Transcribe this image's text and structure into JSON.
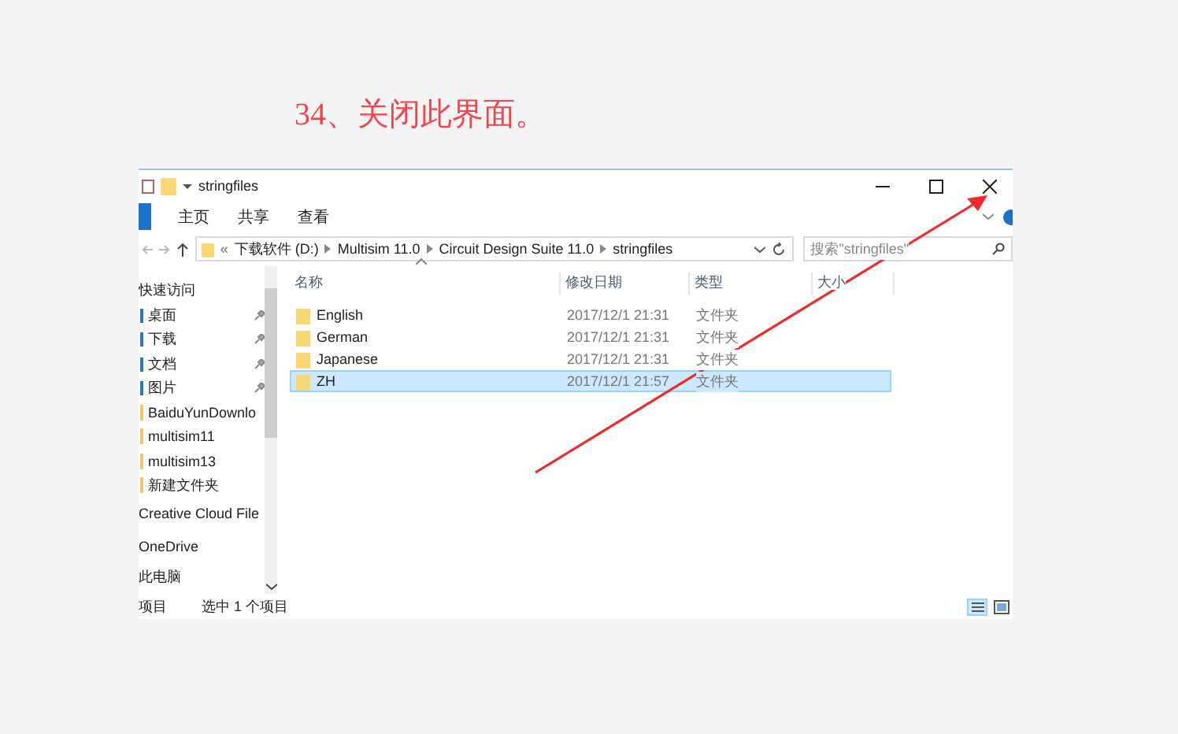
{
  "heading": "34、关闭此界面。",
  "window": {
    "title": "stringfiles"
  },
  "ribbon_tabs": [
    {
      "label": "主页",
      "selected": false
    },
    {
      "label": "共享",
      "selected": false
    },
    {
      "label": "查看",
      "selected": false
    }
  ],
  "address": {
    "overflow": "«",
    "crumbs": [
      "下载软件 (D:)",
      "Multisim 11.0",
      "Circuit Design Suite 11.0",
      "stringfiles"
    ]
  },
  "search": {
    "placeholder": "搜索\"stringfiles\""
  },
  "nav": [
    {
      "label": "快速访问",
      "kind": "header"
    },
    {
      "label": "桌面",
      "kind": "pinned"
    },
    {
      "label": "下载",
      "kind": "pinned"
    },
    {
      "label": "文档",
      "kind": "pinned"
    },
    {
      "label": "图片",
      "kind": "pinned"
    },
    {
      "label": "BaiduYunDownlo",
      "kind": "folder"
    },
    {
      "label": "multisim11",
      "kind": "folder"
    },
    {
      "label": "multisim13",
      "kind": "folder"
    },
    {
      "label": "新建文件夹",
      "kind": "folder"
    },
    {
      "label": "Creative Cloud File",
      "kind": "root"
    },
    {
      "label": "OneDrive",
      "kind": "root"
    },
    {
      "label": "此电脑",
      "kind": "root"
    }
  ],
  "columns": [
    "名称",
    "修改日期",
    "类型",
    "大小"
  ],
  "rows": [
    {
      "name": "English",
      "modified": "2017/12/1 21:31",
      "type": "文件夹",
      "selected": false
    },
    {
      "name": "German",
      "modified": "2017/12/1 21:31",
      "type": "文件夹",
      "selected": false
    },
    {
      "name": "Japanese",
      "modified": "2017/12/1 21:31",
      "type": "文件夹",
      "selected": false
    },
    {
      "name": "ZH",
      "modified": "2017/12/1 21:57",
      "type": "文件夹",
      "selected": true
    }
  ],
  "status_bar": {
    "count": "项目",
    "selection": "选中 1 个项目"
  }
}
